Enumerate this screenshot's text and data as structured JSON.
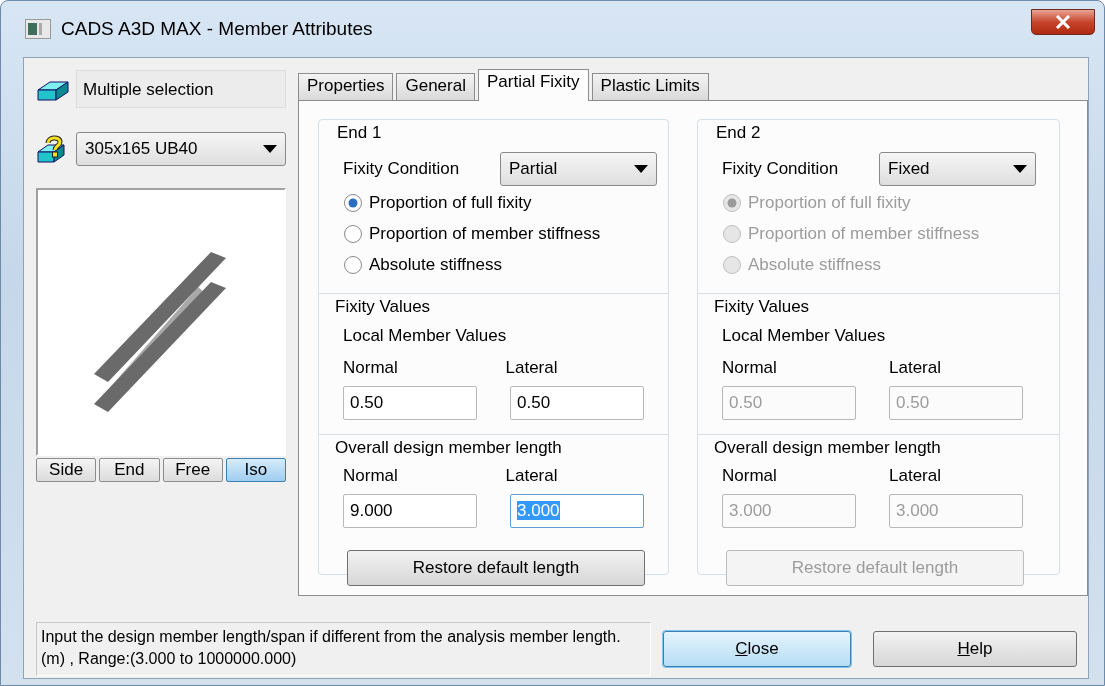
{
  "window": {
    "title": "CADS A3D MAX - Member Attributes"
  },
  "sidebar": {
    "selection": "Multiple selection",
    "section": {
      "value": "305x165 UB40"
    },
    "view_buttons": [
      {
        "label": "Side",
        "selected": false
      },
      {
        "label": "End",
        "selected": false
      },
      {
        "label": "Free",
        "selected": false
      },
      {
        "label": "Iso",
        "selected": true
      }
    ]
  },
  "tabs": [
    {
      "label": "Properties",
      "selected": false
    },
    {
      "label": "General",
      "selected": false
    },
    {
      "label": "Partial Fixity",
      "selected": true
    },
    {
      "label": "Plastic Limits",
      "selected": false
    }
  ],
  "ends": [
    {
      "title": "End 1",
      "disabled": false,
      "fixity_label": "Fixity Condition",
      "fixity": {
        "value": "Partial"
      },
      "options": [
        {
          "label": "Proportion of full fixity",
          "checked": true
        },
        {
          "label": "Proportion of member stiffness",
          "checked": false
        },
        {
          "label": "Absolute stiffness",
          "checked": false
        }
      ],
      "fixity_values": {
        "title": "Fixity Values",
        "subtitle": "Local Member Values",
        "fields": [
          {
            "label": "Normal",
            "value": "0.50",
            "selected": false
          },
          {
            "label": "Lateral",
            "value": "0.50",
            "selected": false
          }
        ]
      },
      "length": {
        "title": "Overall design member length",
        "fields": [
          {
            "label": "Normal",
            "value": "9.000",
            "selected": false
          },
          {
            "label": "Lateral",
            "value": "3.000",
            "selected": true
          }
        ]
      },
      "restore_button": "Restore default length"
    },
    {
      "title": "End 2",
      "disabled": true,
      "fixity_label": "Fixity Condition",
      "fixity": {
        "value": "Fixed"
      },
      "options": [
        {
          "label": "Proportion of full fixity",
          "checked": true
        },
        {
          "label": "Proportion of member stiffness",
          "checked": false
        },
        {
          "label": "Absolute stiffness",
          "checked": false
        }
      ],
      "fixity_values": {
        "title": "Fixity Values",
        "subtitle": "Local Member Values",
        "fields": [
          {
            "label": "Normal",
            "value": "0.50",
            "selected": false
          },
          {
            "label": "Lateral",
            "value": "0.50",
            "selected": false
          }
        ]
      },
      "length": {
        "title": "Overall design member length",
        "fields": [
          {
            "label": "Normal",
            "value": "3.000",
            "selected": false
          },
          {
            "label": "Lateral",
            "value": "3.000",
            "selected": false
          }
        ]
      },
      "restore_button": "Restore default length"
    }
  ],
  "hint": "Input the design member length/span if different from the analysis member length. (m) , Range:(3.000 to 1000000.000)",
  "buttons": [
    {
      "label": "Close",
      "default": true,
      "underline_first": true
    },
    {
      "label": "Help",
      "default": false,
      "underline_first": true
    }
  ]
}
